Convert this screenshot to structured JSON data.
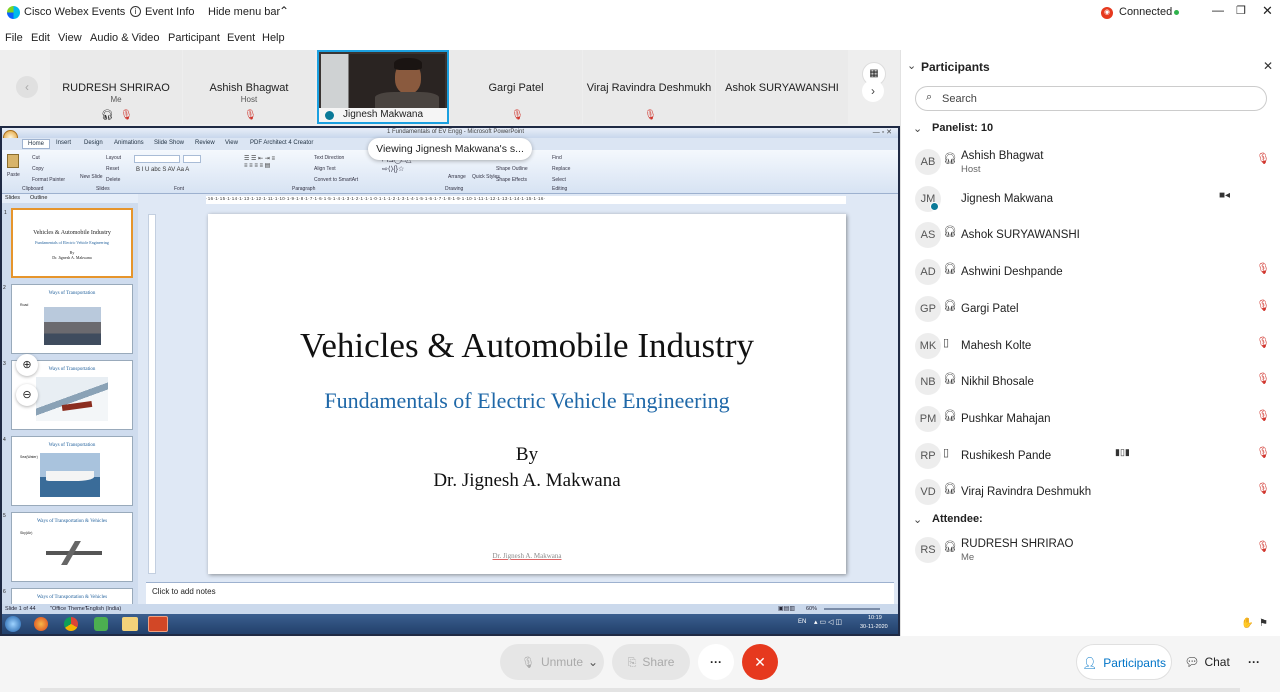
{
  "app": {
    "title": "Cisco Webex Events",
    "event_info": "Event Info",
    "hide_menu": "Hide menu bar",
    "status": "Connected"
  },
  "menu": [
    "File",
    "Edit",
    "View",
    "Audio & Video",
    "Participant",
    "Event",
    "Help"
  ],
  "strip": {
    "tiles": [
      {
        "name": "RUDRESH SHRIRAO",
        "sub": "Me"
      },
      {
        "name": "Ashish Bhagwat",
        "sub": "Host"
      },
      {
        "name": "Jignesh Makwana",
        "sub": ""
      },
      {
        "name": "Gargi Patel",
        "sub": ""
      },
      {
        "name": "Viraj Ravindra Deshmukh",
        "sub": ""
      },
      {
        "name": "Ashok SURYAWANSHI",
        "sub": ""
      }
    ]
  },
  "share": {
    "viewing_label": "Viewing Jignesh Makwana's s...",
    "ppt_title": "1 Fundamentals of EV Engg - Microsoft PowerPoint",
    "tabs": [
      "Home",
      "Insert",
      "Design",
      "Animations",
      "Slide Show",
      "Review",
      "View",
      "PDF Architect 4 Creator"
    ],
    "groups": [
      "Clipboard",
      "Slides",
      "Font",
      "Paragraph",
      "Drawing",
      "Editing"
    ],
    "ribbon_cmds": [
      "Cut",
      "Copy",
      "Format Painter",
      "Paste",
      "Layout",
      "Reset",
      "Delete",
      "New Slide",
      "Text Direction",
      "Align Text",
      "Convert to SmartArt",
      "Arrange",
      "Quick Styles",
      "Shape Fill",
      "Shape Outline",
      "Shape Effects",
      "Find",
      "Replace",
      "Select"
    ],
    "pane_tabs": [
      "Slides",
      "Outline"
    ],
    "thumbs": [
      {
        "num": "1",
        "title": "Vehicles & Automobile Industry",
        "sub": "Fundamentals of Electric Vehicle Engineering",
        "by": "By",
        "author": "Dr. Jignesh A. Makwana"
      },
      {
        "num": "2",
        "title": "Ways of Transportation",
        "sub": "Road"
      },
      {
        "num": "3",
        "title": "Ways of Transportation",
        "sub": ""
      },
      {
        "num": "4",
        "title": "Ways of Transportation",
        "sub": "Sea(Water)"
      },
      {
        "num": "5",
        "title": "Ways of Transportation & Vehicles",
        "sub": "Sky(Air)"
      },
      {
        "num": "6",
        "title": "Ways of Transportation & Vehicles",
        "sub": ""
      }
    ],
    "slide": {
      "title": "Vehicles & Automobile Industry",
      "subtitle": "Fundamentals of Electric Vehicle Engineering",
      "by": "By",
      "author": "Dr. Jignesh A. Makwana",
      "footer": "Dr. Jignesh A. Makwana"
    },
    "notes": "Click to add notes",
    "status_left": "Slide 1 of 44",
    "status_theme": "\"Office Theme\"",
    "status_lang": "English (India)",
    "zoom": "60%",
    "taskbar_lang": "EN",
    "clock_time": "10:19",
    "clock_date": "30-11-2020",
    "ruler": "·16·1·15·1·14·1·13·1·12·1·11·1·10·1·9·1·8·1·7·1·6·1·5·1·4·1·3·1·2·1·1·1·0·1·1·1·2·1·3·1·4·1·5·1·6·1·7·1·8·1·9·1·10·1·11·1·12·1·13·1·14·1·15·1·16·"
  },
  "panel": {
    "title": "Participants",
    "search_placeholder": "Search",
    "panelist_header": "Panelist: 10",
    "attendee_header": "Attendee:",
    "panelists": [
      {
        "initials": "AB",
        "name": "Ashish Bhagwat",
        "role": "Host",
        "icon": "headset-icon",
        "right": "mic-muted"
      },
      {
        "initials": "JM",
        "name": "Jignesh Makwana",
        "role": "",
        "icon": "",
        "right": "video"
      },
      {
        "initials": "AS",
        "name": "Ashok SURYAWANSHI",
        "role": "",
        "icon": "headset-icon",
        "right": ""
      },
      {
        "initials": "AD",
        "name": "Ashwini Deshpande",
        "role": "",
        "icon": "headset-icon",
        "right": "mic-muted"
      },
      {
        "initials": "GP",
        "name": "Gargi Patel",
        "role": "",
        "icon": "headset-icon",
        "right": "mic-muted"
      },
      {
        "initials": "MK",
        "name": "Mahesh Kolte",
        "role": "",
        "icon": "phone-icon",
        "right": "mic-muted"
      },
      {
        "initials": "NB",
        "name": "Nikhil Bhosale",
        "role": "",
        "icon": "headset-icon",
        "right": "mic-muted"
      },
      {
        "initials": "PM",
        "name": "Pushkar Mahajan",
        "role": "",
        "icon": "headset-icon",
        "right": "mic-muted"
      },
      {
        "initials": "RP",
        "name": "Rushikesh Pande",
        "role": "",
        "icon": "phone-icon",
        "right": "mic-muted"
      },
      {
        "initials": "VD",
        "name": "Viraj Ravindra Deshmukh",
        "role": "",
        "icon": "headset-icon",
        "right": "mic-muted"
      }
    ],
    "attendees": [
      {
        "initials": "RS",
        "name": "RUDRESH SHRIRAO",
        "role": "Me",
        "icon": "headset-icon",
        "right": "mic-muted"
      }
    ]
  },
  "bottom": {
    "unmute": "Unmute",
    "share": "Share",
    "more": "···",
    "participants": "Participants",
    "chat": "Chat"
  },
  "colors": {
    "accent": "#0074c7",
    "danger": "#e6391e",
    "connected": "#2fb24c"
  }
}
